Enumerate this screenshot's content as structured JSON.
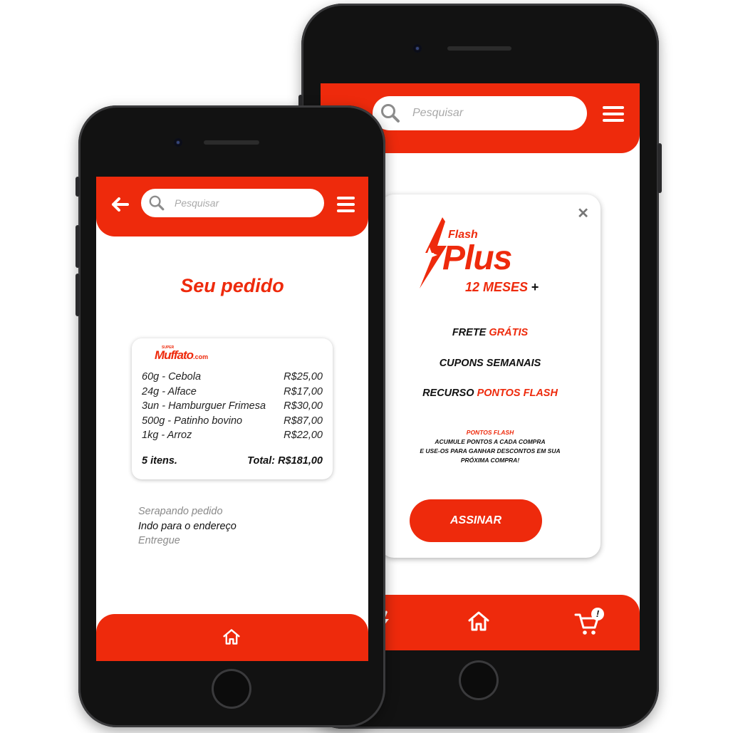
{
  "left_phone": {
    "search": {
      "placeholder": "Pesquisar"
    },
    "page_title": "Seu pedido",
    "store_logo": {
      "small_text": "SUPER",
      "brand": "Muffato",
      "suffix": ".com"
    },
    "order_items": [
      {
        "desc": "60g  - Cebola",
        "price": "R$25,00"
      },
      {
        "desc": "24g - Alface",
        "price": "R$17,00"
      },
      {
        "desc": "3un - Hamburguer Frimesa",
        "price": "R$30,00"
      },
      {
        "desc": "500g - Patinho bovino",
        "price": "R$87,00"
      },
      {
        "desc": "1kg - Arroz",
        "price": "R$22,00"
      }
    ],
    "item_count": "5 itens.",
    "total": "Total: R$181,00",
    "status_steps": [
      {
        "label": "Serapando pedido",
        "state": "done"
      },
      {
        "label": "Indo para o endereço",
        "state": "current"
      },
      {
        "label": "Entregue",
        "state": "pending"
      }
    ]
  },
  "right_phone": {
    "search": {
      "placeholder": "Pesquisar"
    },
    "modal": {
      "logo_small": "Flash",
      "logo_big": "Plus",
      "duration": "12 MESES",
      "duration_plus": "+",
      "benefit_1": {
        "black": "FRETE ",
        "red": "GRÁTIS"
      },
      "benefit_2": {
        "black": "CUPONS SEMANAIS",
        "red": ""
      },
      "benefit_3": {
        "black": "RECURSO ",
        "red": "PONTOS FLASH"
      },
      "note_title": "PONTOS FLASH",
      "note_lines": [
        "ACUMULE PONTOS A CADA COMPRA",
        "E USE-OS PARA GANHAR DESCONTOS EM SUA",
        "PRÓXIMA COMPRA!"
      ],
      "subscribe_label": "ASSINAR",
      "close_glyph": "✕"
    },
    "cart_badge": "!"
  },
  "colors": {
    "accent": "#ee2a0c",
    "text": "#111111",
    "muted": "#8a8a8a"
  }
}
